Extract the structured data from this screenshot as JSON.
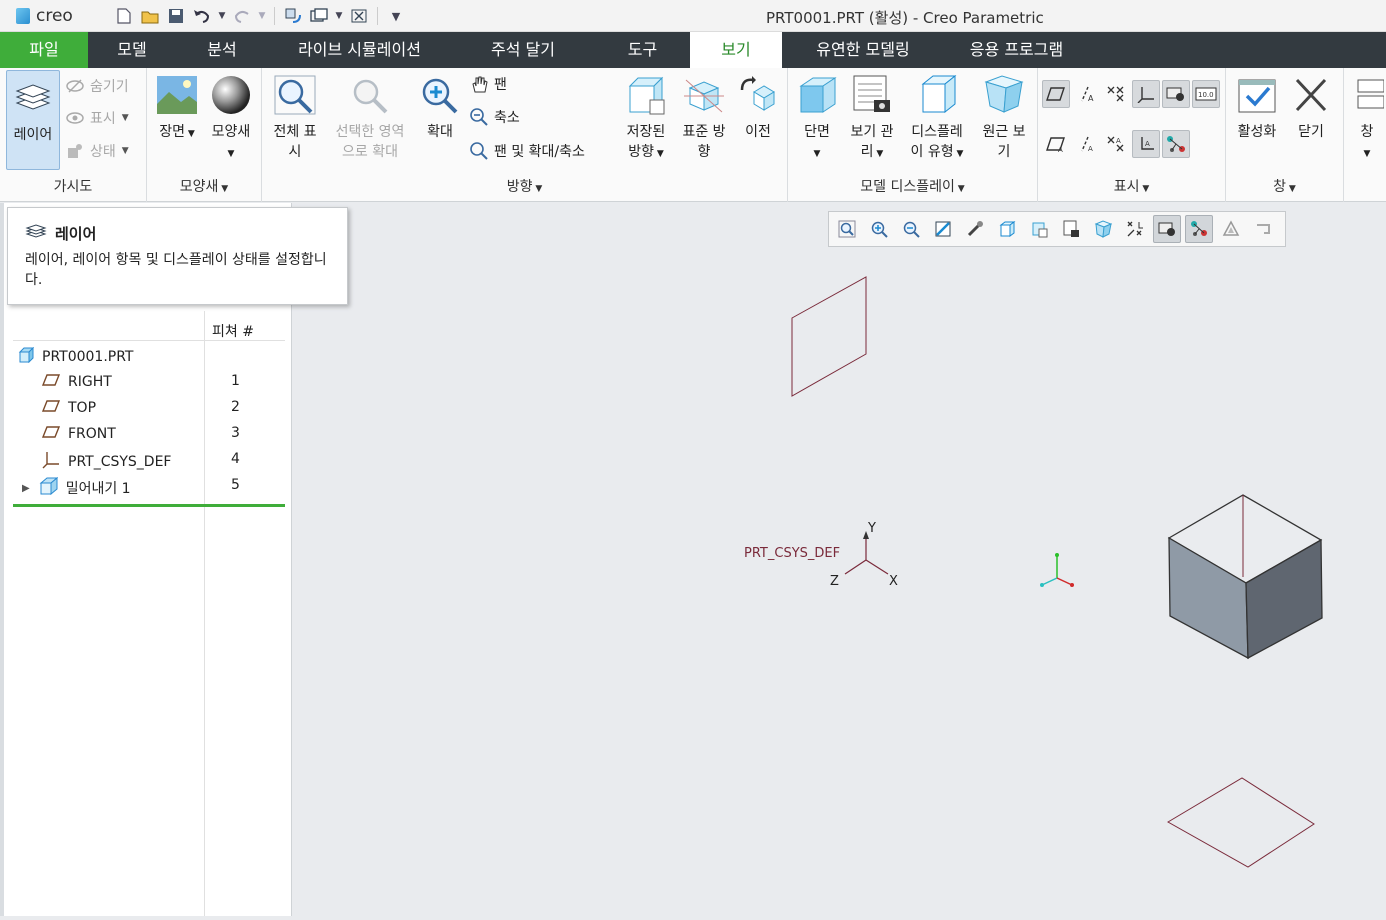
{
  "app": {
    "logo": "creo",
    "title": "PRT0001.PRT (활성) - Creo Parametric"
  },
  "quick_access": [
    "new-icon",
    "open-icon",
    "save-icon",
    "undo-icon",
    "redo-icon",
    "regenerate-icon",
    "window-icon",
    "close-window-icon",
    "customize-icon"
  ],
  "tabs": [
    "파일",
    "모델",
    "분석",
    "라이브 시뮬레이션",
    "주석 달기",
    "도구",
    "보기",
    "유연한 모델링",
    "응용 프로그램"
  ],
  "active_tab": "보기",
  "ribbon": {
    "visibility": {
      "label": "가시도",
      "layers": "레이어",
      "hide": "숨기기",
      "show": "표시",
      "status": "상태"
    },
    "appearance": {
      "label": "모양새",
      "scene": "장면",
      "appearance": "모양새"
    },
    "orientation": {
      "label": "방향",
      "refit_1": "전체 표",
      "refit_2": "시",
      "zoom_sel_1": "선택한 영역",
      "zoom_sel_2": "으로 확대",
      "zoom_in": "확대",
      "pan": "팬",
      "zoom_out": "축소",
      "pan_zoom": "팬 및 확대/축소",
      "saved_1": "저장된",
      "saved_2": "방향",
      "std_1": "표준 방",
      "std_2": "향",
      "prev": "이전"
    },
    "model_display": {
      "label": "모델 디스플레이",
      "section": "단면",
      "vm_1": "보기 관",
      "vm_2": "리",
      "dstyle_1": "디스플레",
      "dstyle_2": "이 유형",
      "persp_1": "원근 보",
      "persp_2": "기"
    },
    "show": {
      "label": "표시"
    },
    "window": {
      "label": "창",
      "activate": "활성화",
      "close": "닫기",
      "windows": "창"
    }
  },
  "tooltip": {
    "title": "레이어",
    "desc": "레이어, 레이어 항목 및 디스플레이 상태를 설정합니다."
  },
  "model_tree": {
    "column": "피쳐 #",
    "root": "PRT0001.PRT",
    "items": [
      {
        "name": "RIGHT",
        "num": "1"
      },
      {
        "name": "TOP",
        "num": "2"
      },
      {
        "name": "FRONT",
        "num": "3"
      },
      {
        "name": "PRT_CSYS_DEF",
        "num": "4"
      },
      {
        "name": "밀어내기 1",
        "num": "5"
      }
    ]
  },
  "viewport": {
    "csys_label": "PRT_CSYS_DEF",
    "axis_x": "X",
    "axis_y": "Y",
    "axis_z": "Z",
    "datum_color": "#7a2a3a",
    "solid_color": "#8f9aa6"
  }
}
